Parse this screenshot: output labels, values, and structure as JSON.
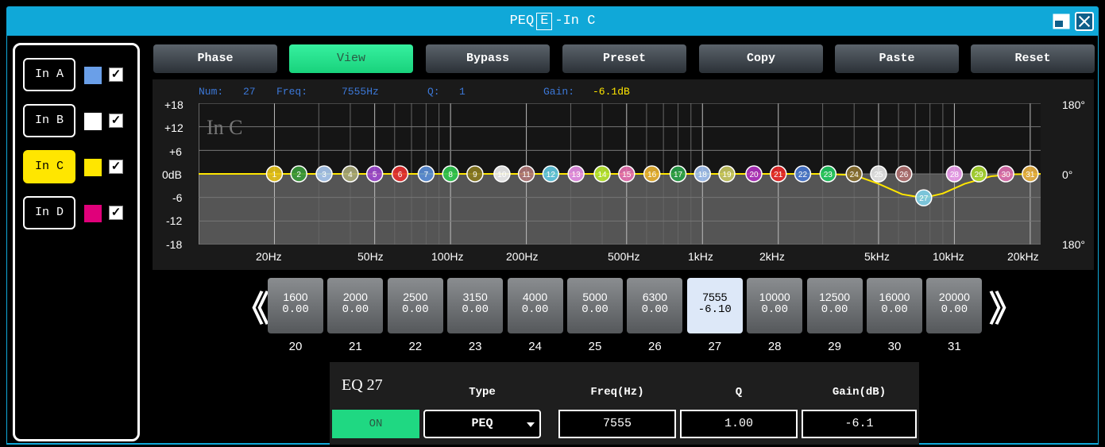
{
  "window": {
    "title_prefix": "PEQ",
    "title_badge": "E",
    "title_suffix": "-In C",
    "titlebar_color": "#10a8d8"
  },
  "channels": [
    {
      "label": "In A",
      "color": "#6a9fe8",
      "checked": true,
      "active": false
    },
    {
      "label": "In B",
      "color": "#ffffff",
      "checked": true,
      "active": false
    },
    {
      "label": "In C",
      "color": "#ffe600",
      "checked": true,
      "active": true
    },
    {
      "label": "In D",
      "color": "#e0007a",
      "checked": true,
      "active": false
    }
  ],
  "toolbar": {
    "phase": "Phase",
    "view": "View",
    "bypass": "Bypass",
    "preset": "Preset",
    "copy": "Copy",
    "paste": "Paste",
    "reset": "Reset"
  },
  "readout": {
    "num_label": "Num:",
    "num": "27",
    "freq_label": "Freq:",
    "freq": "7555Hz",
    "q_label": "Q:",
    "q": "1",
    "gain_label": "Gain:",
    "gain": "-6.1dB"
  },
  "graph": {
    "watermark": "In C",
    "right_top": "180°",
    "right_mid": "0°",
    "right_bottom": "180°"
  },
  "chart_data": {
    "type": "line",
    "title": "",
    "xlabel": "",
    "ylabel": "",
    "x_scale": "log",
    "xlim": [
      10,
      22000
    ],
    "ylim": [
      -18,
      18
    ],
    "y_ticks": [
      "+18",
      "+12",
      "+6",
      "0dB",
      "-6",
      "-12",
      "-18"
    ],
    "x_ticks": [
      {
        "hz": 20,
        "label": "20Hz"
      },
      {
        "hz": 50,
        "label": "50Hz"
      },
      {
        "hz": 100,
        "label": "100Hz"
      },
      {
        "hz": 200,
        "label": "200Hz"
      },
      {
        "hz": 500,
        "label": "500Hz"
      },
      {
        "hz": 1000,
        "label": "1kHz"
      },
      {
        "hz": 2000,
        "label": "2kHz"
      },
      {
        "hz": 5000,
        "label": "5kHz"
      },
      {
        "hz": 10000,
        "label": "10kHz"
      },
      {
        "hz": 20000,
        "label": "20kHz"
      }
    ],
    "curve_color": "#ffe600",
    "series": [
      {
        "values": [
          {
            "x": 10,
            "y": 0
          },
          {
            "x": 3000,
            "y": 0
          },
          {
            "x": 4000,
            "y": -0.3
          },
          {
            "x": 5000,
            "y": -2.5
          },
          {
            "x": 6200,
            "y": -5.2
          },
          {
            "x": 7555,
            "y": -6.1
          },
          {
            "x": 9000,
            "y": -5.0
          },
          {
            "x": 11000,
            "y": -2.5
          },
          {
            "x": 14000,
            "y": -0.6
          },
          {
            "x": 17000,
            "y": -0.1
          },
          {
            "x": 22000,
            "y": 0
          }
        ]
      }
    ],
    "bands": [
      {
        "n": "1",
        "hz": 20,
        "gain": 0,
        "color": "#e8c41a"
      },
      {
        "n": "2",
        "hz": 25,
        "gain": 0,
        "color": "#3a9a3a"
      },
      {
        "n": "3",
        "hz": 31.5,
        "gain": 0,
        "color": "#a8c8f0"
      },
      {
        "n": "4",
        "hz": 40,
        "gain": 0,
        "color": "#a8a878"
      },
      {
        "n": "5",
        "hz": 50,
        "gain": 0,
        "color": "#a04ad0"
      },
      {
        "n": "6",
        "hz": 63,
        "gain": 0,
        "color": "#e83030"
      },
      {
        "n": "7",
        "hz": 80,
        "gain": 0,
        "color": "#5a8ed8"
      },
      {
        "n": "8",
        "hz": 100,
        "gain": 0,
        "color": "#30c850"
      },
      {
        "n": "9",
        "hz": 125,
        "gain": 0,
        "color": "#8a7a20"
      },
      {
        "n": "10",
        "hz": 160,
        "gain": 0,
        "color": "#f0f0f0"
      },
      {
        "n": "11",
        "hz": 200,
        "gain": 0,
        "color": "#b07878"
      },
      {
        "n": "12",
        "hz": 250,
        "gain": 0,
        "color": "#60c8e0"
      },
      {
        "n": "13",
        "hz": 315,
        "gain": 0,
        "color": "#e890e8"
      },
      {
        "n": "14",
        "hz": 400,
        "gain": 0,
        "color": "#b8e830"
      },
      {
        "n": "15",
        "hz": 500,
        "gain": 0,
        "color": "#e870b0"
      },
      {
        "n": "16",
        "hz": 630,
        "gain": 0,
        "color": "#e8b030"
      },
      {
        "n": "17",
        "hz": 800,
        "gain": 0,
        "color": "#28a048"
      },
      {
        "n": "18",
        "hz": 1000,
        "gain": 0,
        "color": "#a0c0f0"
      },
      {
        "n": "19",
        "hz": 1250,
        "gain": 0,
        "color": "#c8c860"
      },
      {
        "n": "20",
        "hz": 1600,
        "gain": 0,
        "color": "#b030c0"
      },
      {
        "n": "21",
        "hz": 2000,
        "gain": 0,
        "color": "#e82828"
      },
      {
        "n": "22",
        "hz": 2500,
        "gain": 0,
        "color": "#4878d0"
      },
      {
        "n": "23",
        "hz": 3150,
        "gain": 0,
        "color": "#20c860"
      },
      {
        "n": "24",
        "hz": 4000,
        "gain": 0,
        "color": "#8a7030"
      },
      {
        "n": "25",
        "hz": 5000,
        "gain": 0,
        "color": "#e8e8e8"
      },
      {
        "n": "26",
        "hz": 6300,
        "gain": 0,
        "color": "#b07070"
      },
      {
        "n": "27",
        "hz": 7555,
        "gain": -6.1,
        "color": "#80d0e8"
      },
      {
        "n": "28",
        "hz": 10000,
        "gain": 0,
        "color": "#f0a0f0"
      },
      {
        "n": "29",
        "hz": 12500,
        "gain": 0,
        "color": "#a8d830"
      },
      {
        "n": "30",
        "hz": 16000,
        "gain": 0,
        "color": "#e070b0"
      },
      {
        "n": "31",
        "hz": 20000,
        "gain": 0,
        "color": "#e8b040"
      }
    ]
  },
  "band_strip": {
    "prev_arrow": "《",
    "next_arrow": "》",
    "items": [
      {
        "freq": "1600",
        "gain": "0.00",
        "num": "20",
        "selected": false
      },
      {
        "freq": "2000",
        "gain": "0.00",
        "num": "21",
        "selected": false
      },
      {
        "freq": "2500",
        "gain": "0.00",
        "num": "22",
        "selected": false
      },
      {
        "freq": "3150",
        "gain": "0.00",
        "num": "23",
        "selected": false
      },
      {
        "freq": "4000",
        "gain": "0.00",
        "num": "24",
        "selected": false
      },
      {
        "freq": "5000",
        "gain": "0.00",
        "num": "25",
        "selected": false
      },
      {
        "freq": "6300",
        "gain": "0.00",
        "num": "26",
        "selected": false
      },
      {
        "freq": "7555",
        "gain": "-6.10",
        "num": "27",
        "selected": true
      },
      {
        "freq": "10000",
        "gain": "0.00",
        "num": "28",
        "selected": false
      },
      {
        "freq": "12500",
        "gain": "0.00",
        "num": "29",
        "selected": false
      },
      {
        "freq": "16000",
        "gain": "0.00",
        "num": "30",
        "selected": false
      },
      {
        "freq": "20000",
        "gain": "0.00",
        "num": "31",
        "selected": false
      }
    ]
  },
  "editor": {
    "title": "EQ 27",
    "on_label": "ON",
    "type_header": "Type",
    "type_value": "PEQ",
    "freq_header": "Freq(Hz)",
    "freq_value": "7555",
    "q_header": "Q",
    "q_value": "1.00",
    "gain_header": "Gain(dB)",
    "gain_value": "-6.1"
  }
}
